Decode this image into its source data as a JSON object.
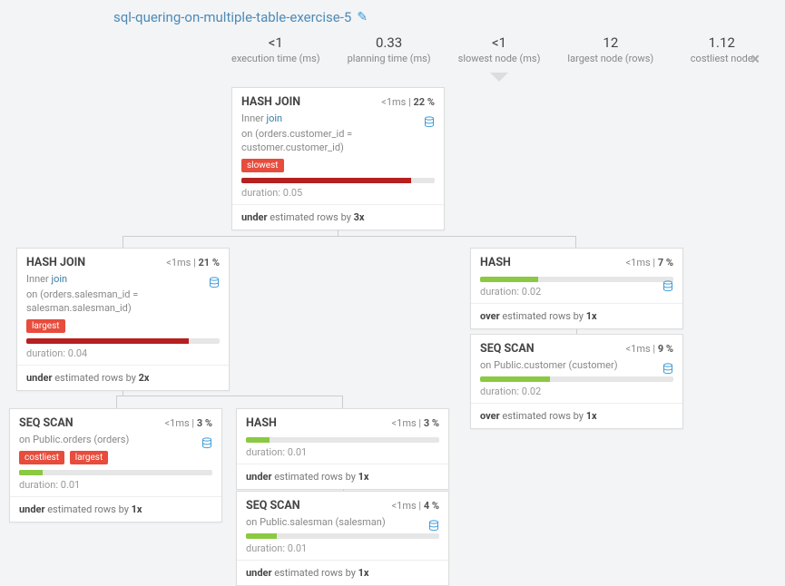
{
  "title": "sql-quering-on-multiple-table-exercise-5",
  "stats": [
    {
      "value": "<1",
      "label": "execution time (ms)"
    },
    {
      "value": "0.33",
      "label": "planning time (ms)"
    },
    {
      "value": "<1",
      "label": "slowest node (ms)"
    },
    {
      "value": "12",
      "label": "largest node (rows)"
    },
    {
      "value": "1.12",
      "label": "costliest node"
    }
  ],
  "nodes": {
    "root": {
      "name": "HASH JOIN",
      "time": "<1ms",
      "pct": "22 %",
      "join_prefix": "Inner ",
      "join_kw": "join",
      "join_cond": "on (orders.customer_id = customer.customer_id)",
      "badges": [
        "slowest"
      ],
      "bar_color": "red",
      "bar_pct": 88,
      "duration": "duration: 0.05",
      "est_prefix": "under",
      "est_mid": " estimated rows by ",
      "est_factor": "3x"
    },
    "hj2": {
      "name": "HASH JOIN",
      "time": "<1ms",
      "pct": "21 %",
      "join_prefix": "Inner ",
      "join_kw": "join",
      "join_cond": "on (orders.salesman_id = salesman.salesman_id)",
      "badges": [
        "largest"
      ],
      "bar_color": "red",
      "bar_pct": 84,
      "duration": "duration: 0.04",
      "est_prefix": "under",
      "est_mid": " estimated rows by ",
      "est_factor": "2x"
    },
    "hash_r": {
      "name": "HASH",
      "time": "<1ms",
      "pct": "7 %",
      "bar_color": "green",
      "bar_pct": 30,
      "duration": "duration: 0.02",
      "est_prefix": "over",
      "est_mid": " estimated rows by ",
      "est_factor": "1x"
    },
    "seq_cust": {
      "name": "SEQ SCAN",
      "time": "<1ms",
      "pct": "9 %",
      "subline": "on Public.customer (customer)",
      "bar_color": "green",
      "bar_pct": 36,
      "duration": "duration: 0.02",
      "est_prefix": "over",
      "est_mid": " estimated rows by ",
      "est_factor": "1x"
    },
    "seq_orders": {
      "name": "SEQ SCAN",
      "time": "<1ms",
      "pct": "3 %",
      "subline": "on Public.orders (orders)",
      "badges": [
        "costliest",
        "largest"
      ],
      "bar_color": "green",
      "bar_pct": 12,
      "duration": "duration: 0.01",
      "est_prefix": "under",
      "est_mid": " estimated rows by ",
      "est_factor": "1x"
    },
    "hash_c": {
      "name": "HASH",
      "time": "<1ms",
      "pct": "3 %",
      "bar_color": "green",
      "bar_pct": 12,
      "duration": "duration: 0.01",
      "est_prefix": "under",
      "est_mid": " estimated rows by ",
      "est_factor": "1x"
    },
    "seq_sales": {
      "name": "SEQ SCAN",
      "time": "<1ms",
      "pct": "4 %",
      "subline": "on Public.salesman (salesman)",
      "bar_color": "green",
      "bar_pct": 16,
      "duration": "duration: 0.01",
      "est_prefix": "under",
      "est_mid": " estimated rows by ",
      "est_factor": "1x"
    }
  }
}
